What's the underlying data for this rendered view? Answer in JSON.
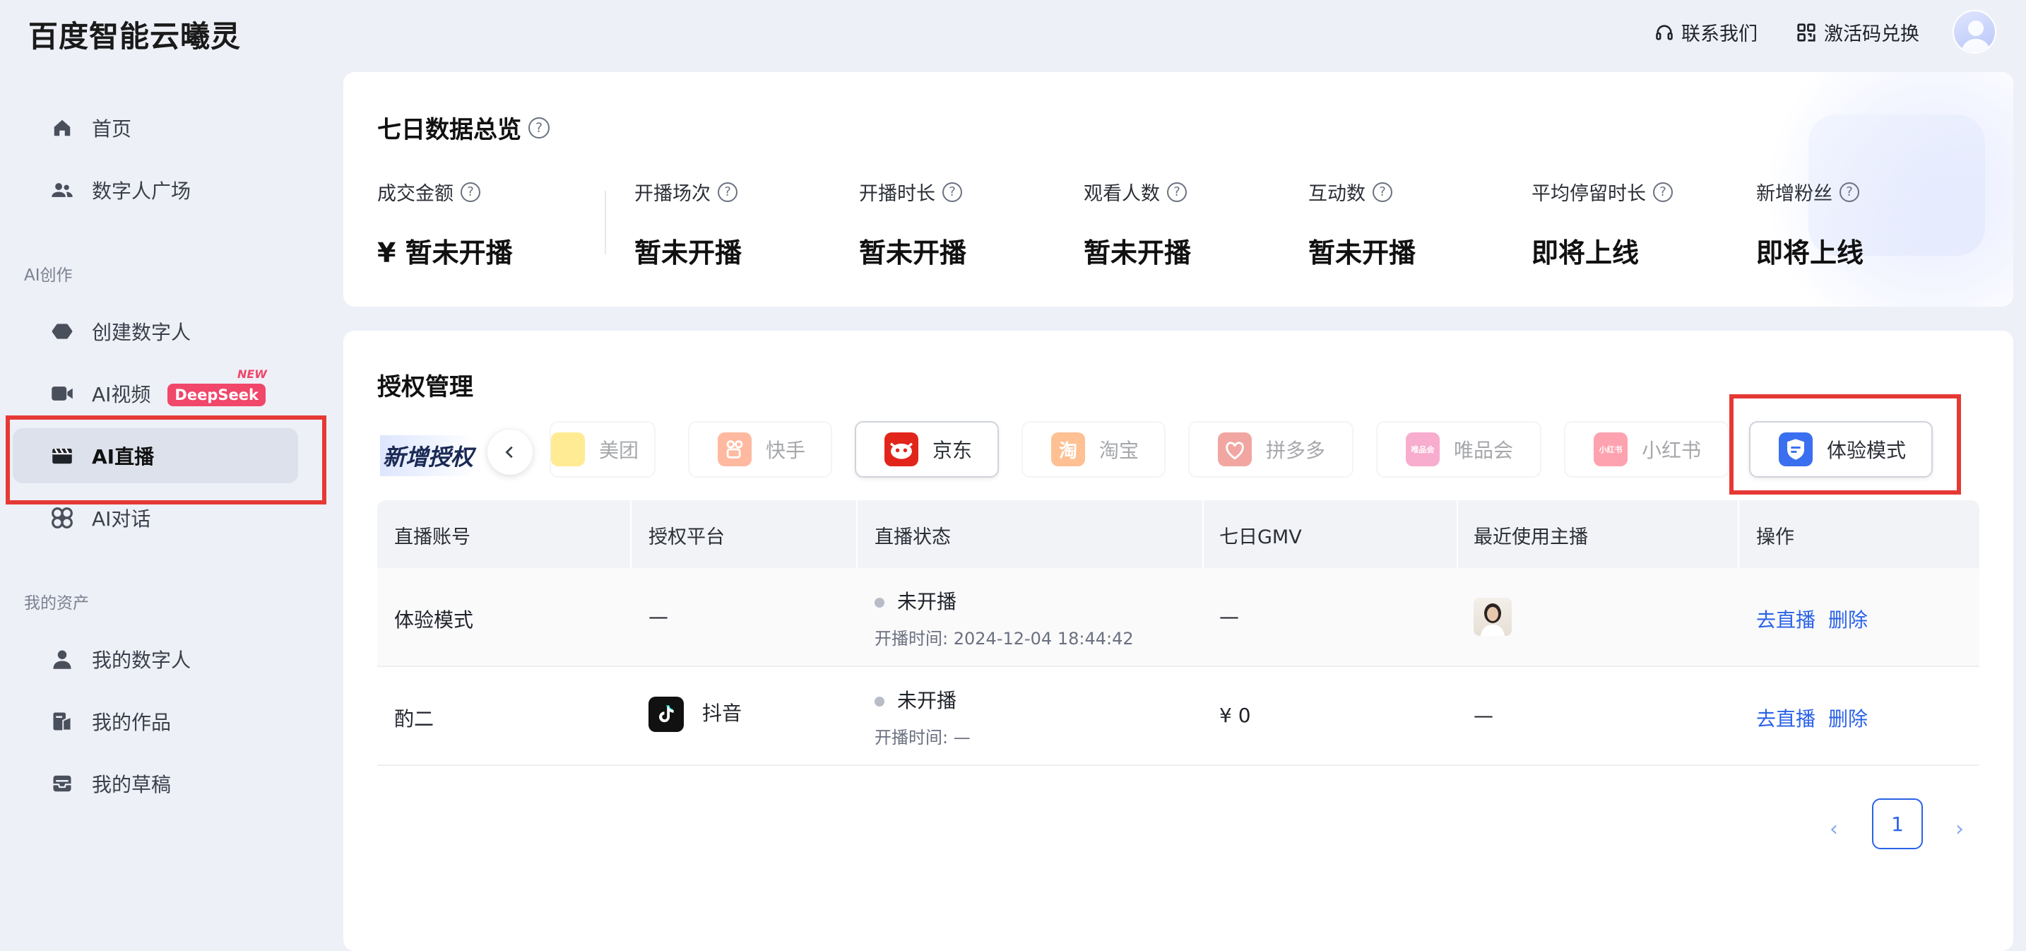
{
  "app": {
    "title": "百度智能云曦灵"
  },
  "topbar": {
    "contact_label": "联系我们",
    "activation_label": "激活码兑换"
  },
  "sidebar": {
    "items": [
      {
        "label": "首页",
        "icon": "home-icon"
      },
      {
        "label": "数字人广场",
        "icon": "users-icon"
      }
    ],
    "section_ai": "AI创作",
    "ai_items": [
      {
        "label": "创建数字人",
        "icon": "cloud-icon"
      },
      {
        "label": "AI视频",
        "icon": "video-icon",
        "badge": "DeepSeek",
        "badge_new": "NEW"
      },
      {
        "label": "AI直播",
        "icon": "clapper-icon",
        "active": true
      },
      {
        "label": "AI对话",
        "icon": "chat-icon"
      }
    ],
    "section_assets": "我的资产",
    "asset_items": [
      {
        "label": "我的数字人",
        "icon": "person-icon"
      },
      {
        "label": "我的作品",
        "icon": "works-icon"
      },
      {
        "label": "我的草稿",
        "icon": "draft-icon"
      }
    ]
  },
  "overview": {
    "title": "七日数据总览",
    "stats": [
      {
        "label": "成交金额",
        "value": "¥ 暂未开播"
      },
      {
        "label": "开播场次",
        "value": "暂未开播"
      },
      {
        "label": "开播时长",
        "value": "暂未开播"
      },
      {
        "label": "观看人数",
        "value": "暂未开播"
      },
      {
        "label": "互动数",
        "value": "暂未开播"
      },
      {
        "label": "平均停留时长",
        "value": "即将上线"
      },
      {
        "label": "新增粉丝",
        "value": "即将上线"
      }
    ]
  },
  "auth": {
    "title": "授权管理",
    "add_label": "新增授权",
    "platforms": [
      {
        "label": "美团",
        "icon": "meituan-icon",
        "color": "#ffd100",
        "faded": true
      },
      {
        "label": "快手",
        "icon": "kuaishou-icon",
        "color": "#ff5a1f",
        "faded": true
      },
      {
        "label": "京东",
        "icon": "jd-icon",
        "color": "#e1251b",
        "faded": false
      },
      {
        "label": "淘宝",
        "icon": "taobao-icon",
        "color": "#ff6a00",
        "faded": true
      },
      {
        "label": "拼多多",
        "icon": "pinduoduo-icon",
        "color": "#e02e24",
        "faded": true
      },
      {
        "label": "唯品会",
        "icon": "vip-icon",
        "color": "#f03c8c",
        "faded": true
      },
      {
        "label": "小红书",
        "icon": "xiaohongshu-icon",
        "color": "#ff2442",
        "faded": true
      },
      {
        "label": "体验模式",
        "icon": "trial-shield-icon",
        "color": "#3a6ff0",
        "faded": false
      }
    ],
    "columns": [
      "直播账号",
      "授权平台",
      "直播状态",
      "七日GMV",
      "最近使用主播",
      "操作"
    ],
    "rows": [
      {
        "account": "体验模式",
        "platform": "—",
        "status": "未开播",
        "start_time": "开播时间: 2024-12-04 18:44:42",
        "gmv": "—",
        "anchor": "",
        "action_live": "去直播",
        "action_delete": "删除"
      },
      {
        "account": "酌二",
        "platform": "抖音",
        "status": "未开播",
        "start_time": "开播时间: —",
        "gmv": "¥ 0",
        "anchor": "—",
        "action_live": "去直播",
        "action_delete": "删除"
      }
    ],
    "pagination": {
      "current": "1"
    }
  }
}
